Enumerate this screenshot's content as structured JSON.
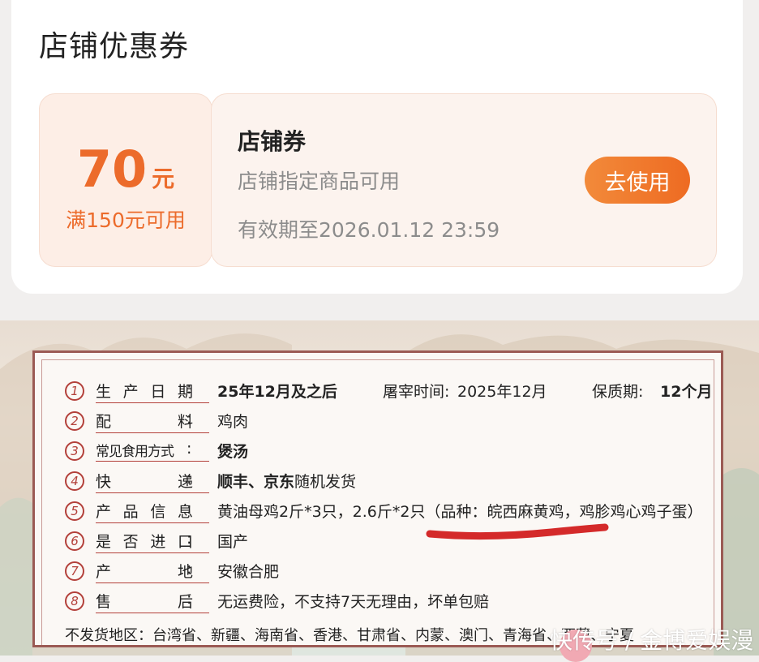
{
  "coupon_section": {
    "title": "店铺优惠券",
    "coupon": {
      "amount": "70",
      "unit": "元",
      "condition": "满150元可用",
      "name": "店铺券",
      "scope": "店铺指定商品可用",
      "validity": "有效期至2026.01.12 23:59",
      "use_button": "去使用"
    }
  },
  "colors": {
    "accent": "#ec6b2b",
    "frame": "#9b5a54",
    "badge": "#b3403a",
    "highlight_mark": "#d42a2a"
  },
  "product_info": {
    "rows": [
      {
        "num": "1",
        "label": "生产日期",
        "values": [
          "25年12月及之后"
        ],
        "extra": [
          {
            "label": "屠宰时间:",
            "value": "2025年12月"
          },
          {
            "label": "保质期:",
            "value": "12个月"
          }
        ]
      },
      {
        "num": "2",
        "label": "配料",
        "values": [
          "鸡肉"
        ]
      },
      {
        "num": "3",
        "label": "常见食用方式",
        "values": [
          "煲汤"
        ]
      },
      {
        "num": "4",
        "label": "快递",
        "values": [
          "顺丰、京东",
          "随机发货"
        ]
      },
      {
        "num": "5",
        "label": "产品信息",
        "values": [
          "黄油母鸡2斤*3只，2.6斤*2只（品种：皖西麻黄鸡，鸡胗鸡心鸡子蛋）"
        ]
      },
      {
        "num": "6",
        "label": "是否进口",
        "values": [
          "国产"
        ]
      },
      {
        "num": "7",
        "label": "产地",
        "values": [
          "安徽合肥"
        ]
      },
      {
        "num": "8",
        "label": "售后",
        "values": [
          "无运费险，不支持7天无理由，坏单包赔"
        ]
      }
    ],
    "no_ship_note": "不发货地区：台湾省、新疆、海南省、香港、甘肃省、内蒙、澳门、青海省、西藏、宁夏"
  },
  "watermark": "快传号 / 金博爱娱漫"
}
